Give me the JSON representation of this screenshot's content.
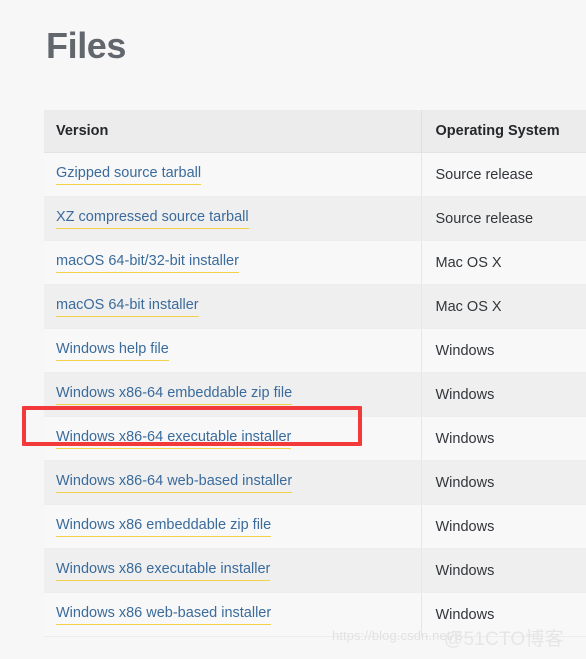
{
  "page": {
    "title": "Files",
    "background_color": "#f7f7f8"
  },
  "table": {
    "columns": [
      {
        "key": "version",
        "label": "Version"
      },
      {
        "key": "os",
        "label": "Operating System"
      }
    ],
    "rows": [
      {
        "version": "Gzipped source tarball",
        "os": "Source release"
      },
      {
        "version": "XZ compressed source tarball",
        "os": "Source release"
      },
      {
        "version": "macOS 64-bit/32-bit installer",
        "os": "Mac OS X"
      },
      {
        "version": "macOS 64-bit installer",
        "os": "Mac OS X"
      },
      {
        "version": "Windows help file",
        "os": "Windows"
      },
      {
        "version": "Windows x86-64 embeddable zip file",
        "os": "Windows"
      },
      {
        "version": "Windows x86-64 executable installer",
        "os": "Windows"
      },
      {
        "version": "Windows x86-64 web-based installer",
        "os": "Windows"
      },
      {
        "version": "Windows x86 embeddable zip file",
        "os": "Windows"
      },
      {
        "version": "Windows x86 executable installer",
        "os": "Windows"
      },
      {
        "version": "Windows x86 web-based installer",
        "os": "Windows"
      }
    ]
  },
  "annotation": {
    "highlighted_row_version": "Windows x86-64 executable installer",
    "box_color": "#f23a3a"
  },
  "watermarks": {
    "url": "https://blog.csdn.net/S",
    "brand": "@51CTO博客"
  },
  "colors": {
    "link": "#3a6b9c",
    "link_underline": "#f2d24b",
    "header_bg": "#ececec",
    "row_odd_bg": "#f8f8f8",
    "row_even_bg": "#efefef",
    "title": "#62666d"
  }
}
